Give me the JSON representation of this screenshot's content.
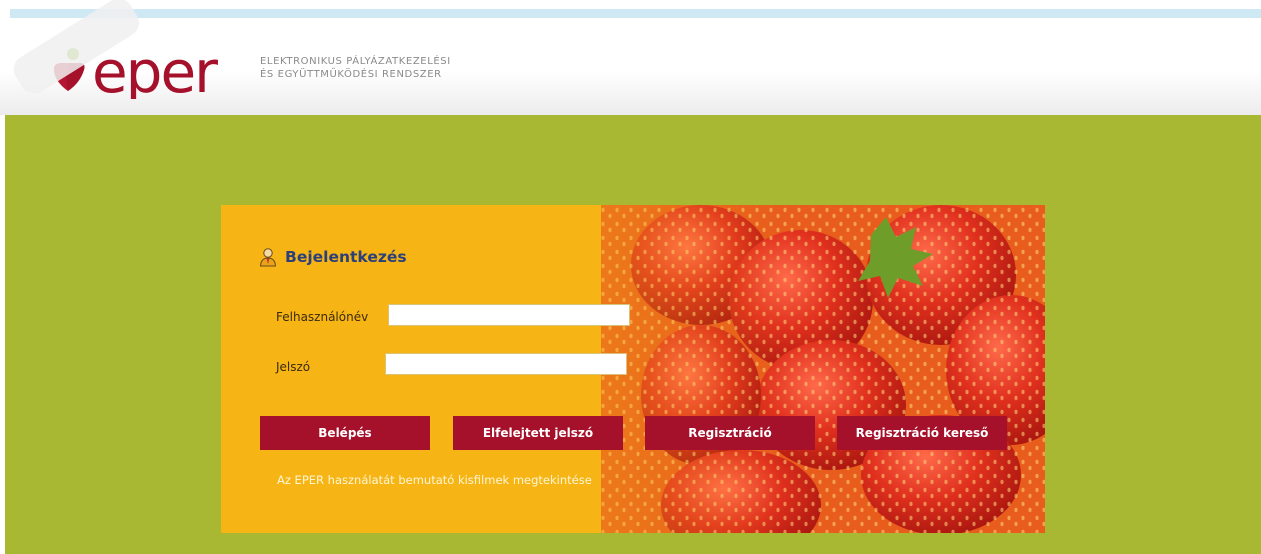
{
  "header": {
    "logo_text": "eper",
    "subtitle_line1": "ELEKTRONIKUS PÁLYÁZATKEZELÉSI",
    "subtitle_line2": "ÉS EGYÜTTMŰKÖDÉSI RENDSZER"
  },
  "login": {
    "title": "Bejelentkezés",
    "username_label": "Felhasználónév",
    "username_value": "",
    "password_label": "Jelszó",
    "password_value": "",
    "buttons": {
      "login": "Belépés",
      "forgot_password": "Elfelejtett jelszó",
      "registration": "Regisztráció",
      "registration_search": "Regisztráció kereső"
    },
    "video_link": "Az EPER használatát bemutató kisfilmek megtekintése"
  },
  "icons": {
    "logo": "eper-logo-icon",
    "user": "user-icon",
    "background_image": "strawberries-image"
  },
  "colors": {
    "page_bg": "#a9b833",
    "panel_bg": "#f6b514",
    "button_bg": "#a5102a",
    "title_color": "#2b3f7a",
    "logo_color": "#a5102a",
    "logo_dot_green": "#8dbb2a"
  }
}
